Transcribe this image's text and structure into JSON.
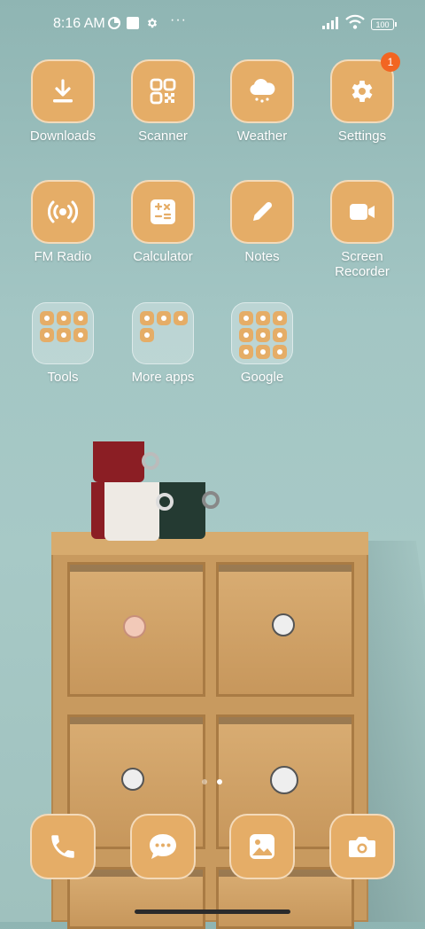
{
  "status_bar": {
    "time": "8:16 AM",
    "battery": "100",
    "more": "···"
  },
  "apps": [
    {
      "label": "Downloads",
      "icon": "download-icon"
    },
    {
      "label": "Scanner",
      "icon": "qr-scanner-icon"
    },
    {
      "label": "Weather",
      "icon": "cloud-rain-icon"
    },
    {
      "label": "Settings",
      "icon": "gear-icon",
      "badge": "1"
    },
    {
      "label": "FM Radio",
      "icon": "radio-icon"
    },
    {
      "label": "Calculator",
      "icon": "calculator-icon"
    },
    {
      "label": "Notes",
      "icon": "pencil-icon"
    },
    {
      "label": "Screen\nRecorder",
      "line1": "Screen",
      "line2": "Recorder",
      "icon": "video-camera-icon"
    }
  ],
  "folders": [
    {
      "label": "Tools"
    },
    {
      "label": "More apps"
    },
    {
      "label": "Google"
    }
  ],
  "dock": [
    {
      "icon": "phone-icon"
    },
    {
      "icon": "message-icon"
    },
    {
      "icon": "gallery-icon"
    },
    {
      "icon": "camera-icon"
    }
  ],
  "colors": {
    "tile": "#e5ad67",
    "badge": "#f26522"
  }
}
